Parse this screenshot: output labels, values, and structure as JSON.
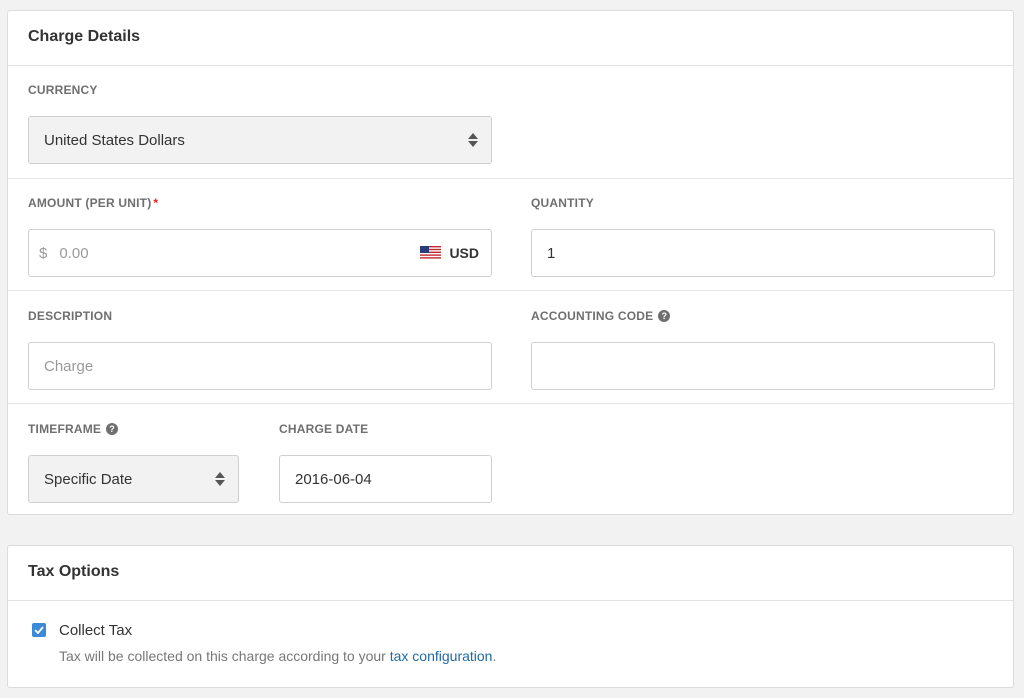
{
  "charge_panel": {
    "title": "Charge Details",
    "currency": {
      "label": "CURRENCY",
      "value": "United States Dollars"
    },
    "amount": {
      "label": "AMOUNT (PER UNIT)",
      "required_mark": "*",
      "prefix": "$",
      "placeholder": "0.00",
      "currency_code": "USD",
      "flag_icon": "us-flag-icon"
    },
    "quantity": {
      "label": "QUANTITY",
      "value": "1"
    },
    "description": {
      "label": "DESCRIPTION",
      "placeholder": "Charge"
    },
    "accounting_code": {
      "label": "ACCOUNTING CODE",
      "help_icon": "question-circle-icon",
      "value": ""
    },
    "timeframe": {
      "label": "TIMEFRAME",
      "help_icon": "question-circle-icon",
      "value": "Specific Date"
    },
    "charge_date": {
      "label": "CHARGE DATE",
      "value": "2016-06-04"
    }
  },
  "tax_panel": {
    "title": "Tax Options",
    "collect_tax": {
      "label": "Collect Tax",
      "checked": true,
      "note_prefix": "Tax will be collected on this charge according to your",
      "link_text": "tax configuration",
      "note_suffix": "."
    }
  },
  "colors": {
    "accent": "#3b8ad9",
    "link": "#1f6aa5",
    "required": "#e02424"
  }
}
